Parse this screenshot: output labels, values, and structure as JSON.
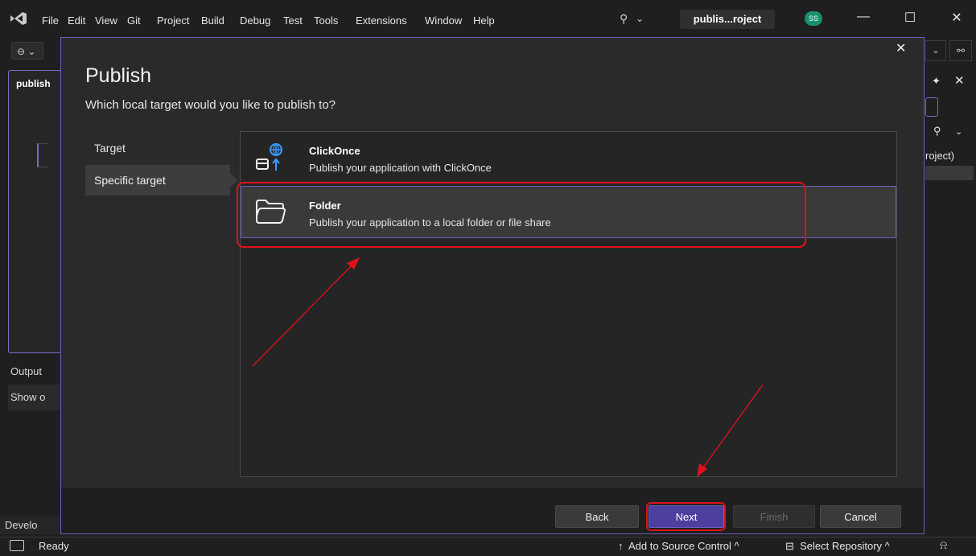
{
  "menubar": {
    "items": [
      "File",
      "Edit",
      "View",
      "Git",
      "Project",
      "Build",
      "Debug",
      "Test",
      "Tools",
      "Extensions",
      "Window",
      "Help"
    ],
    "project_chip": "publis...roject",
    "avatar_initials": "SS"
  },
  "background": {
    "left_panel_title": "publish",
    "output_tab": "Output",
    "output_dropdown": "Show o",
    "dev_tab": "Develo",
    "right_project_label": "roject)"
  },
  "statusbar": {
    "ready": "Ready",
    "source_control": "Add to Source Control",
    "repository": "Select Repository"
  },
  "dialog": {
    "title": "Publish",
    "subtitle": "Which local target would you like to publish to?",
    "nav": {
      "target": "Target",
      "specific_target": "Specific target"
    },
    "options": [
      {
        "title": "ClickOnce",
        "description": "Publish your application with ClickOnce",
        "icon": "clickonce-icon"
      },
      {
        "title": "Folder",
        "description": "Publish your application to a local folder or file share",
        "icon": "folder-icon",
        "selected": true
      }
    ],
    "buttons": {
      "back": "Back",
      "next": "Next",
      "finish": "Finish",
      "cancel": "Cancel"
    }
  },
  "colors": {
    "accent": "#6f5fbf",
    "next_button": "#4c3f9e",
    "annotation_red": "#e0111b",
    "clickonce_globe": "#3d9bff"
  }
}
